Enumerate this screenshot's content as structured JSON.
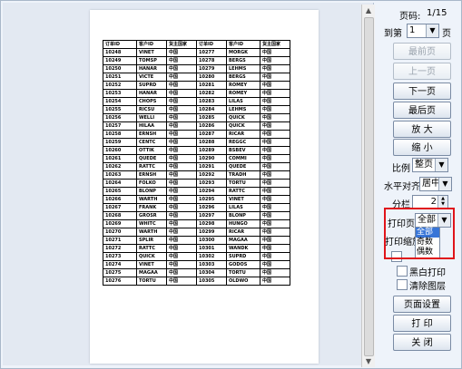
{
  "preview": {
    "columns": [
      "订单ID",
      "客户ID",
      "货主国家",
      "订单ID",
      "客户ID",
      "货主国家"
    ],
    "rows": [
      [
        "10248",
        "VINET",
        "中国",
        "10277",
        "MORGK",
        "中国"
      ],
      [
        "10249",
        "TOMSP",
        "中国",
        "10278",
        "BERGS",
        "中国"
      ],
      [
        "10250",
        "HANAR",
        "中国",
        "10279",
        "LEHMS",
        "中国"
      ],
      [
        "10251",
        "VICTE",
        "中国",
        "10280",
        "BERGS",
        "中国"
      ],
      [
        "10252",
        "SUPRD",
        "中国",
        "10281",
        "ROMEY",
        "中国"
      ],
      [
        "10253",
        "HANAR",
        "中国",
        "10282",
        "ROMEY",
        "中国"
      ],
      [
        "10254",
        "CHOPS",
        "中国",
        "10283",
        "LILAS",
        "中国"
      ],
      [
        "10255",
        "RICSU",
        "中国",
        "10284",
        "LEHMS",
        "中国"
      ],
      [
        "10256",
        "WELLI",
        "中国",
        "10285",
        "QUICK",
        "中国"
      ],
      [
        "10257",
        "HILAA",
        "中国",
        "10286",
        "QUICK",
        "中国"
      ],
      [
        "10258",
        "ERNSH",
        "中国",
        "10287",
        "RICAR",
        "中国"
      ],
      [
        "10259",
        "CENTC",
        "中国",
        "10288",
        "REGGC",
        "中国"
      ],
      [
        "10260",
        "OTTIK",
        "中国",
        "10289",
        "BSBEV",
        "中国"
      ],
      [
        "10261",
        "QUEDE",
        "中国",
        "10290",
        "COMMI",
        "中国"
      ],
      [
        "10262",
        "RATTC",
        "中国",
        "10291",
        "QUEDE",
        "中国"
      ],
      [
        "10263",
        "ERNSH",
        "中国",
        "10292",
        "TRADH",
        "中国"
      ],
      [
        "10264",
        "FOLKO",
        "中国",
        "10293",
        "TORTU",
        "中国"
      ],
      [
        "10265",
        "BLONP",
        "中国",
        "10294",
        "RATTC",
        "中国"
      ],
      [
        "10266",
        "WARTH",
        "中国",
        "10295",
        "VINET",
        "中国"
      ],
      [
        "10267",
        "FRANK",
        "中国",
        "10296",
        "LILAS",
        "中国"
      ],
      [
        "10268",
        "GROSR",
        "中国",
        "10297",
        "BLONP",
        "中国"
      ],
      [
        "10269",
        "WHITC",
        "中国",
        "10298",
        "HUNGO",
        "中国"
      ],
      [
        "10270",
        "WARTH",
        "中国",
        "10299",
        "RICAR",
        "中国"
      ],
      [
        "10271",
        "SPLIR",
        "中国",
        "10300",
        "MAGAA",
        "中国"
      ],
      [
        "10272",
        "RATTC",
        "中国",
        "10301",
        "WANDK",
        "中国"
      ],
      [
        "10273",
        "QUICK",
        "中国",
        "10302",
        "SUPRD",
        "中国"
      ],
      [
        "10274",
        "VINET",
        "中国",
        "10303",
        "GODOS",
        "中国"
      ],
      [
        "10275",
        "MAGAA",
        "中国",
        "10304",
        "TORTU",
        "中国"
      ],
      [
        "10276",
        "TORTU",
        "中国",
        "10305",
        "OLDWO",
        "中国"
      ]
    ]
  },
  "panel": {
    "page_label": "页码:",
    "page_value": "1/15",
    "goto_label": "到第",
    "goto_value": "1",
    "goto_suffix": "页",
    "first_page": "最前页",
    "prev_page": "上一页",
    "next_page": "下一页",
    "last_page": "最后页",
    "zoom_in": "放 大",
    "zoom_out": "缩 小",
    "ratio_label": "比例",
    "ratio_value": "整页",
    "halign_label": "水平对齐",
    "halign_value": "居中",
    "columns_label": "分栏",
    "columns_value": "2",
    "print_pages_label": "打印页",
    "print_pages_value": "全部",
    "print_pages_options": [
      "全部",
      "奇数",
      "偶数"
    ],
    "print_scale_label": "打印缩放",
    "bw_print": "黑白打印",
    "clear_layer": "清除图层",
    "page_setup": "页面设置",
    "print": "打 印",
    "close": "关 闭"
  },
  "colors": {
    "highlight": "#e0141a",
    "selected": "#3875d7"
  }
}
